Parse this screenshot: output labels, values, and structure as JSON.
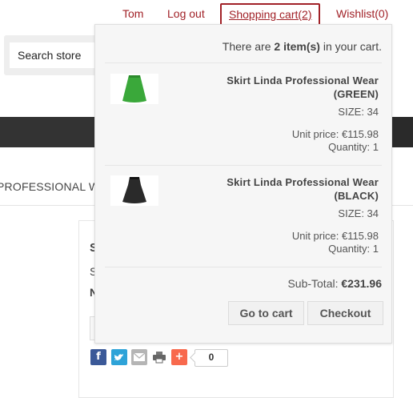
{
  "header": {
    "user_link": "Tom",
    "logout_link": "Log out",
    "cart_link": "Shopping cart(2)",
    "wishlist_link": "Wishlist(0)"
  },
  "search": {
    "placeholder": "Search store"
  },
  "category_breadcrumb": "PROFESSIONAL WE",
  "product_card": {
    "title_fragment": "S",
    "line2_fragment": "S",
    "line3_fragment": "N"
  },
  "share": {
    "icons": [
      "facebook-icon",
      "twitter-icon",
      "email-icon",
      "print-icon",
      "addthis-icon"
    ],
    "count": "0"
  },
  "flyout": {
    "summary_prefix": "There are ",
    "summary_count": "2 item(s)",
    "summary_suffix": " in your cart.",
    "items": [
      {
        "name": "Skirt Linda Professional Wear (GREEN)",
        "attributes": "SIZE: 34",
        "unit_price": "Unit price: €115.98",
        "quantity": "Quantity: 1",
        "color": "#3aa83a"
      },
      {
        "name": "Skirt Linda Professional Wear (BLACK)",
        "attributes": "SIZE: 34",
        "unit_price": "Unit price: €115.98",
        "quantity": "Quantity: 1",
        "color": "#2a2a2a"
      }
    ],
    "subtotal_label": "Sub-Total: ",
    "subtotal_value": "€231.96",
    "go_to_cart_label": "Go to cart",
    "checkout_label": "Checkout"
  },
  "colors": {
    "accent": "#a12127",
    "nav_bar": "#333333",
    "flyout_bg": "#f6f6f6"
  }
}
